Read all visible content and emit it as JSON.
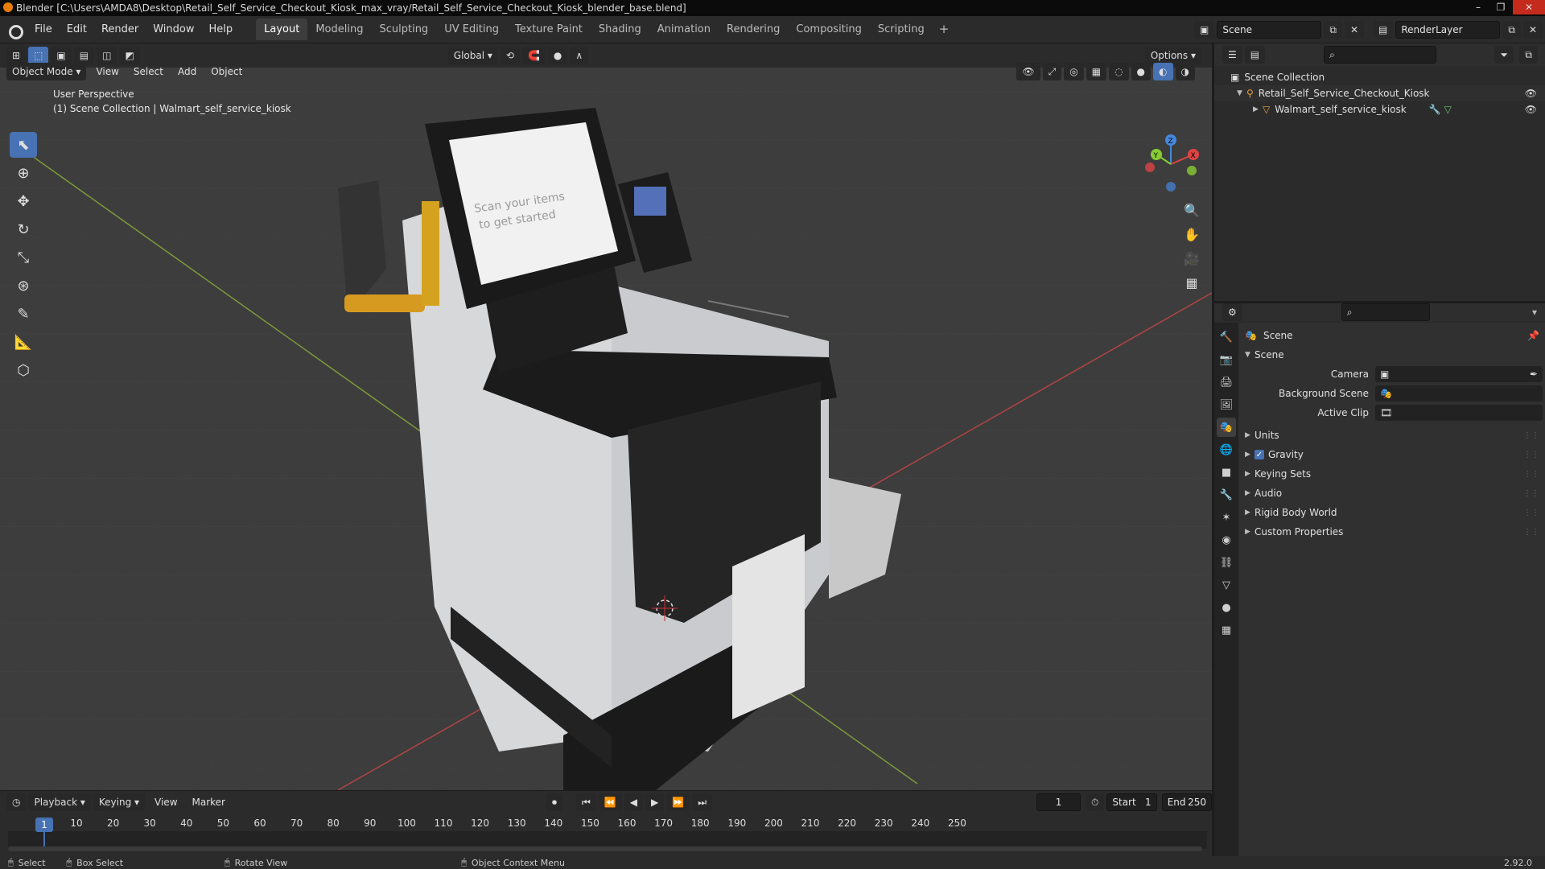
{
  "window": {
    "title": "Blender [C:\\Users\\AMDA8\\Desktop\\Retail_Self_Service_Checkout_Kiosk_max_vray/Retail_Self_Service_Checkout_Kiosk_blender_base.blend]",
    "minimize": "–",
    "maximize": "❐",
    "close": "✕"
  },
  "menu": {
    "items": [
      "File",
      "Edit",
      "Render",
      "Window",
      "Help"
    ]
  },
  "workspaces": {
    "tabs": [
      "Layout",
      "Modeling",
      "Sculpting",
      "UV Editing",
      "Texture Paint",
      "Shading",
      "Animation",
      "Rendering",
      "Compositing",
      "Scripting"
    ],
    "active": "Layout",
    "add": "+"
  },
  "scene_selector": {
    "scene": "Scene",
    "render_layer": "RenderLayer"
  },
  "viewport": {
    "mode": "Object Mode",
    "menus": [
      "View",
      "Select",
      "Add",
      "Object"
    ],
    "transform_orientation": "Global",
    "options": "Options",
    "overlay_line1": "User Perspective",
    "overlay_line2": "(1) Scene Collection | Walmart_self_service_kiosk",
    "screen_text1": "Scan your items",
    "screen_text2": "to get started"
  },
  "gizmo": {
    "x": "X",
    "y": "Y",
    "z": "Z"
  },
  "timeline": {
    "menus": [
      "Playback",
      "Keying",
      "View",
      "Marker"
    ],
    "current_frame": "1",
    "start_label": "Start",
    "start": "1",
    "end_label": "End",
    "end": "250",
    "ticks": [
      "10",
      "20",
      "30",
      "40",
      "50",
      "60",
      "70",
      "80",
      "90",
      "100",
      "110",
      "120",
      "130",
      "140",
      "150",
      "160",
      "170",
      "180",
      "190",
      "200",
      "210",
      "220",
      "230",
      "240",
      "250"
    ],
    "playhead": "1"
  },
  "outliner": {
    "root": "Scene Collection",
    "items": [
      {
        "name": "Retail_Self_Service_Checkout_Kiosk"
      },
      {
        "name": "Walmart_self_service_kiosk"
      }
    ]
  },
  "properties": {
    "context": "Scene",
    "panel": "Scene",
    "camera_label": "Camera",
    "bg_scene_label": "Background Scene",
    "active_clip_label": "Active Clip",
    "sections": [
      "Units",
      "Gravity",
      "Keying Sets",
      "Audio",
      "Rigid Body World",
      "Custom Properties"
    ],
    "gravity_checked": true
  },
  "status": {
    "select": "Select",
    "box_select": "Box Select",
    "rotate_view": "Rotate View",
    "context_menu": "Object Context Menu",
    "version": "2.92.0"
  },
  "colors": {
    "accent": "#4772b3",
    "axis_x": "#d44",
    "axis_y": "#8c3",
    "axis_z": "#48d"
  }
}
